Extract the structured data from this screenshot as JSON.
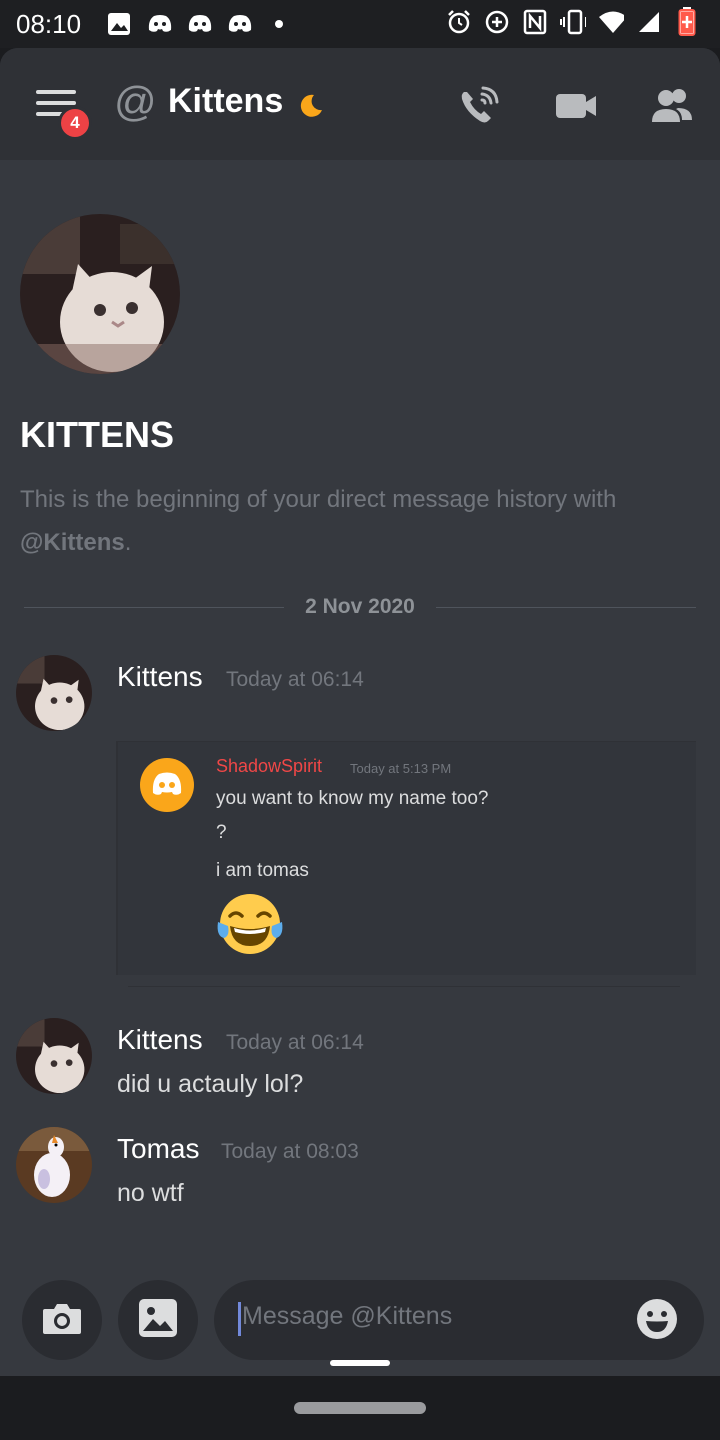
{
  "status_bar": {
    "time": "08:10",
    "left_icons": [
      "image-icon",
      "discord-icon",
      "discord-icon",
      "discord-icon",
      "dot-icon"
    ],
    "right_icons": [
      "alarm-icon",
      "data-saver-icon",
      "nfc-icon",
      "vibrate-icon",
      "wifi-icon",
      "signal-icon",
      "battery-icon"
    ]
  },
  "header": {
    "channel_name": "Kittens",
    "notification_count": "4",
    "status_icon": "moon-icon",
    "actions": [
      "call-icon",
      "video-icon",
      "members-icon"
    ]
  },
  "intro": {
    "title": "KITTENS",
    "text_prefix": "This is the beginning of your direct message history with ",
    "text_mention": "@Kittens",
    "text_suffix": "."
  },
  "date_divider": "2 Nov 2020",
  "messages": [
    {
      "author": "Kittens",
      "time": "Today at 06:14",
      "text": ""
    },
    {
      "author": "Kittens",
      "time": "Today at 06:14",
      "text": "did u actauly lol?"
    },
    {
      "author": "Tomas",
      "time": "Today at 08:03",
      "text": "no wtf"
    }
  ],
  "embed": {
    "author": "ShadowSpirit",
    "time": "Today at 5:13 PM",
    "lines": [
      "you want to know my name too?",
      "?",
      "i am tomas"
    ],
    "emoji": "face-with-tears-of-joy"
  },
  "composer": {
    "placeholder": "Message @Kittens"
  },
  "colors": {
    "background": "#36393f",
    "header": "#2f3136",
    "embed_author": "#f04747",
    "badge": "#ed4245",
    "discord_avatar": "#faa61a"
  }
}
